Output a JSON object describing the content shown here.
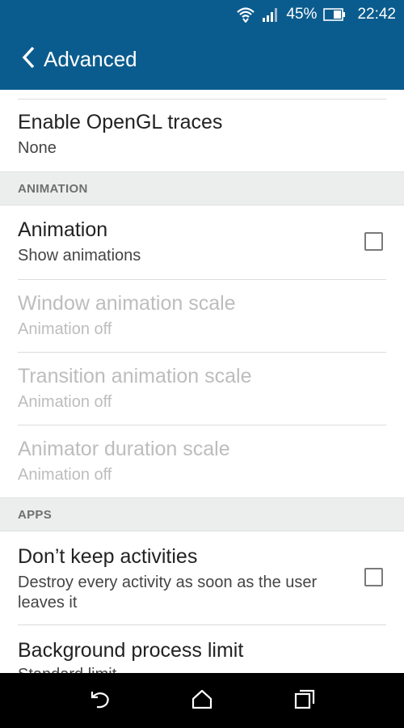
{
  "status_bar": {
    "battery_percent": "45%",
    "time": "22:42",
    "icons": [
      "wifi-icon",
      "signal-icon",
      "battery-icon"
    ]
  },
  "app_bar": {
    "title": "Advanced",
    "back_icon": "chevron-left-icon"
  },
  "items": {
    "opengl": {
      "title": "Enable OpenGL traces",
      "summary": "None"
    },
    "animation": {
      "title": "Animation",
      "summary": "Show animations",
      "checked": false
    },
    "window_scale": {
      "title": "Window animation scale",
      "summary": "Animation off",
      "enabled": false
    },
    "transition_scale": {
      "title": "Transition animation scale",
      "summary": "Animation off",
      "enabled": false
    },
    "animator_scale": {
      "title": "Animator duration scale",
      "summary": "Animation off",
      "enabled": false
    },
    "dont_keep": {
      "title": "Don’t keep activities",
      "summary": "Destroy every activity as soon as the user leaves it",
      "checked": false
    },
    "bg_limit": {
      "title": "Background process limit",
      "summary": "Standard limit"
    }
  },
  "sections": {
    "animation": "ANIMATION",
    "apps": "APPS"
  },
  "nav_bar": {
    "icons": [
      "back-arrow-icon",
      "home-icon",
      "recents-icon"
    ]
  },
  "colors": {
    "primary": "#0b5c8e",
    "section_bg": "#eceeee",
    "disabled_text": "#bdbdbd"
  }
}
